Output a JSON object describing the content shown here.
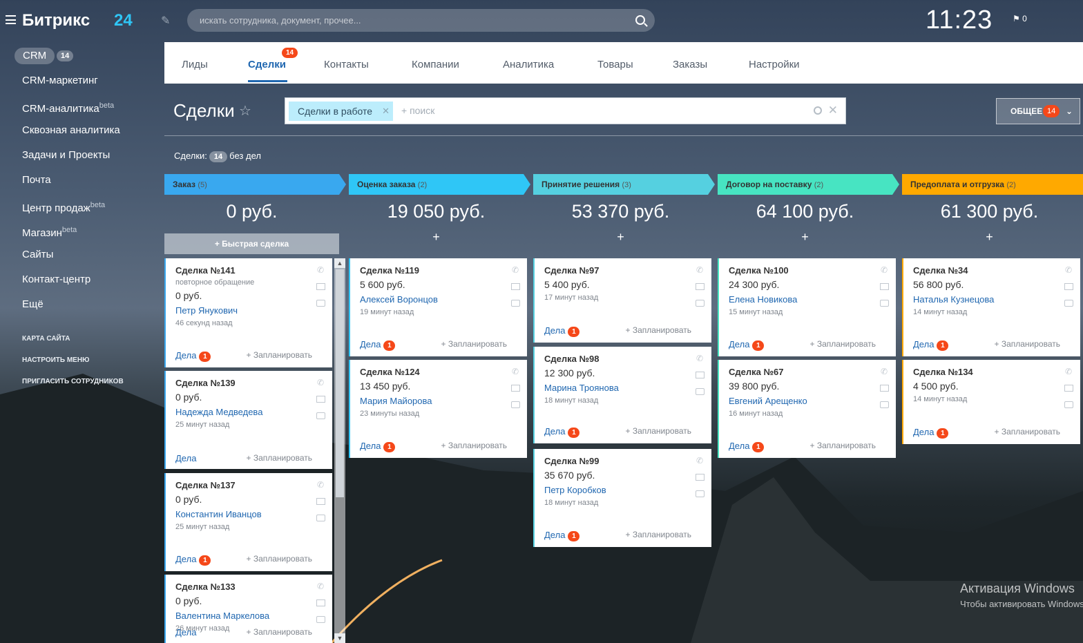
{
  "header": {
    "logo": "Битрикс",
    "logo_num": "24",
    "search_placeholder": "искать сотрудника, документ, прочее...",
    "time": "11:23",
    "flag_count": "0"
  },
  "sidebar": {
    "crm_label": "CRM",
    "crm_count": "14",
    "items": [
      {
        "label": "CRM-маркетинг",
        "sup": ""
      },
      {
        "label": "CRM-аналитика",
        "sup": "beta"
      },
      {
        "label": "Сквозная аналитика",
        "sup": ""
      },
      {
        "label": "Задачи и Проекты",
        "sup": ""
      },
      {
        "label": "Почта",
        "sup": ""
      },
      {
        "label": "Центр продаж",
        "sup": "beta"
      },
      {
        "label": "Магазин",
        "sup": "beta"
      },
      {
        "label": "Сайты",
        "sup": ""
      },
      {
        "label": "Контакт-центр",
        "sup": ""
      },
      {
        "label": "Ещё",
        "sup": ""
      }
    ],
    "links": [
      "КАРТА САЙТА",
      "НАСТРОИТЬ МЕНЮ",
      "ПРИГЛАСИТЬ СОТРУДНИКОВ"
    ]
  },
  "tabs": [
    {
      "label": "Лиды"
    },
    {
      "label": "Сделки",
      "badge": "14"
    },
    {
      "label": "Контакты"
    },
    {
      "label": "Компании"
    },
    {
      "label": "Аналитика"
    },
    {
      "label": "Товары"
    },
    {
      "label": "Заказы"
    },
    {
      "label": "Настройки"
    }
  ],
  "page": {
    "title": "Сделки",
    "filter_chip": "Сделки в работе",
    "filter_placeholder": "+ поиск",
    "general_label": "ОБЩЕЕ",
    "general_count": "14",
    "counter_label": "Сделки:",
    "counter_count": "14",
    "counter_suffix": "без дел"
  },
  "board": {
    "quick_deal": "Быстрая сделка",
    "plan_label": "+ Запланировать",
    "tasks_label": "Дела",
    "columns": [
      {
        "name": "Заказ",
        "count": "(5)",
        "sum": "0 руб.",
        "color": "#39a8ef",
        "cards": [
          {
            "title": "Сделка №141",
            "sub": "повторное обращение",
            "sum": "0 руб.",
            "client": "Петр Янукович",
            "time": "46 секунд назад",
            "tasks": "1"
          },
          {
            "title": "Сделка №139",
            "sub": "",
            "sum": "0 руб.",
            "client": "Надежда Медведева",
            "time": "25 минут назад",
            "tasks": ""
          },
          {
            "title": "Сделка №137",
            "sub": "",
            "sum": "0 руб.",
            "client": "Константин Иванцов",
            "time": "25 минут назад",
            "tasks": "1"
          },
          {
            "title": "Сделка №133",
            "sub": "",
            "sum": "0 руб.",
            "client": "Валентина Маркелова",
            "time": "26 минут назад",
            "tasks": ""
          }
        ]
      },
      {
        "name": "Оценка заказа",
        "count": "(2)",
        "sum": "19 050 руб.",
        "color": "#2fc6f6",
        "cards": [
          {
            "title": "Сделка №119",
            "sub": "",
            "sum": "5 600 руб.",
            "client": "Алексей Воронцов",
            "time": "19 минут назад",
            "tasks": "1"
          },
          {
            "title": "Сделка №124",
            "sub": "",
            "sum": "13 450 руб.",
            "client": "Мария Майорова",
            "time": "23 минуты назад",
            "tasks": "1"
          }
        ]
      },
      {
        "name": "Принятие решения",
        "count": "(3)",
        "sum": "53 370 руб.",
        "color": "#55d0e0",
        "cards": [
          {
            "title": "Сделка №97",
            "sub": "",
            "sum": "5 400 руб.",
            "client": "",
            "time": "17 минут назад",
            "tasks": "1"
          },
          {
            "title": "Сделка №98",
            "sub": "",
            "sum": "12 300 руб.",
            "client": "Марина Троянова",
            "time": "18 минут назад",
            "tasks": "1"
          },
          {
            "title": "Сделка №99",
            "sub": "",
            "sum": "35 670 руб.",
            "client": "Петр Коробков",
            "time": "18 минут назад",
            "tasks": "1"
          }
        ]
      },
      {
        "name": "Договор на поставку",
        "count": "(2)",
        "sum": "64 100 руб.",
        "color": "#47e4c2",
        "cards": [
          {
            "title": "Сделка №100",
            "sub": "",
            "sum": "24 300 руб.",
            "client": "Елена Новикова",
            "time": "15 минут назад",
            "tasks": "1"
          },
          {
            "title": "Сделка №67",
            "sub": "",
            "sum": "39 800 руб.",
            "client": "Евгений Арещенко",
            "time": "16 минут назад",
            "tasks": "1"
          }
        ]
      },
      {
        "name": "Предоплата и отгрузка",
        "count": "(2)",
        "sum": "61 300 руб.",
        "color": "#ffa900",
        "cards": [
          {
            "title": "Сделка №34",
            "sub": "",
            "sum": "56 800 руб.",
            "client": "Наталья Кузнецова",
            "time": "14 минут назад",
            "tasks": "1"
          },
          {
            "title": "Сделка №134",
            "sub": "",
            "sum": "4 500 руб.",
            "client": "",
            "time": "14 минут назад",
            "tasks": "1"
          }
        ]
      }
    ]
  },
  "watermark": {
    "line1": "Активация Windows",
    "line2": "Чтобы активировать Windows"
  }
}
